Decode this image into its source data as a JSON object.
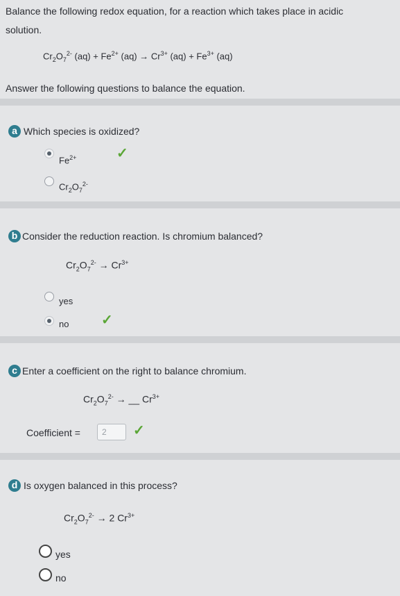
{
  "intro": {
    "line1": "Balance the following redox equation, for a reaction which takes place in acidic",
    "line2": "solution."
  },
  "equation": {
    "cr": "Cr",
    "cr_sub": "2",
    "o": "O",
    "o_sub": "7",
    "dichromate_charge": "2-",
    "aq1": "(aq) + Fe",
    "fe_charge1": "2+",
    "aq2": "(aq) → Cr",
    "cr_charge": "3+",
    "aq3": "(aq) + Fe",
    "fe_charge2": "3+",
    "aq4": "(aq)"
  },
  "answer_prompt": "Answer the following questions to balance the equation.",
  "q_a": {
    "badge": "a",
    "question": "Which species is oxidized?",
    "options": [
      {
        "base": "Fe",
        "sup": "2+",
        "selected": true,
        "correct": true
      },
      {
        "base": "Cr",
        "sub1": "2",
        "mid": "O",
        "sub2": "7",
        "sup": "2-",
        "selected": false
      }
    ]
  },
  "q_b": {
    "badge": "b",
    "question": "Consider the reduction reaction. Is chromium balanced?",
    "reaction": {
      "lhs_base": "Cr",
      "lhs_sub1": "2",
      "lhs_mid": "O",
      "lhs_sub2": "7",
      "lhs_sup": "2-",
      "arrow": "→",
      "rhs_base": "Cr",
      "rhs_sup": "3+"
    },
    "options": [
      {
        "label": "yes",
        "selected": false
      },
      {
        "label": "no",
        "selected": true,
        "correct": true
      }
    ]
  },
  "q_c": {
    "badge": "c",
    "question": "Enter a coefficient on the right to balance chromium.",
    "reaction": {
      "lhs_base": "Cr",
      "lhs_sub1": "2",
      "lhs_mid": "O",
      "lhs_sub2": "7",
      "lhs_sup": "2-",
      "arrow": "→",
      "blank": "__",
      "rhs_base": "Cr",
      "rhs_sup": "3+"
    },
    "coef_label": "Coefficient =",
    "coef_value": "2",
    "correct": true
  },
  "q_d": {
    "badge": "d",
    "question": "Is oxygen balanced in this process?",
    "reaction": {
      "lhs_base": "Cr",
      "lhs_sub1": "2",
      "lhs_mid": "O",
      "lhs_sub2": "7",
      "lhs_sup": "2-",
      "arrow": "→",
      "rhs_coef": "2",
      "rhs_base": "Cr",
      "rhs_sup": "3+"
    },
    "options": [
      {
        "label": "yes",
        "selected": false
      },
      {
        "label": "no",
        "selected": false
      }
    ]
  },
  "icons": {
    "check": "checkmark-icon"
  }
}
